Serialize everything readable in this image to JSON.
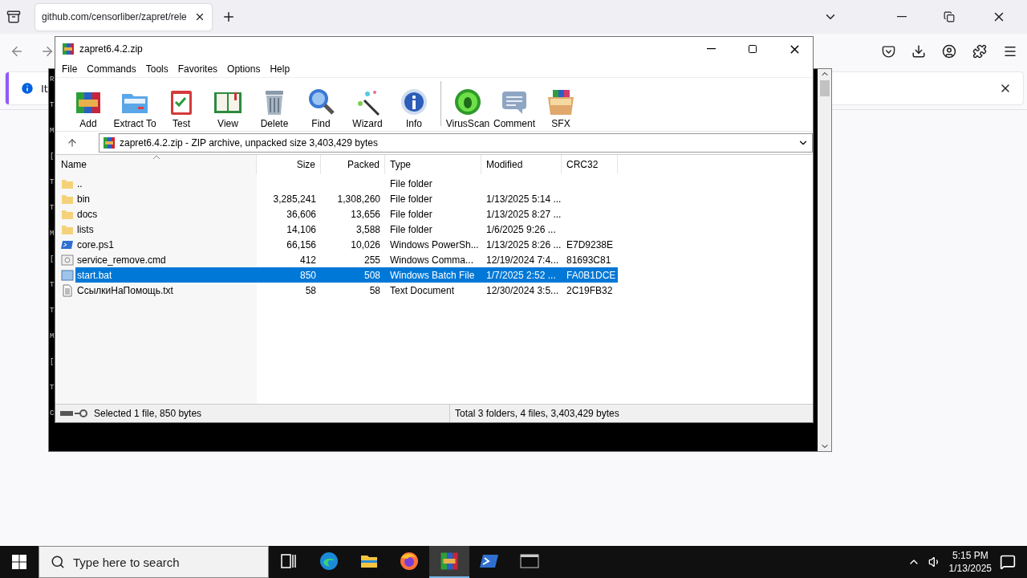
{
  "browser": {
    "tab_title": "github.com/censorliber/zapret/rele",
    "notification_text": "It"
  },
  "console": {
    "lines": [
      "R",
      "T",
      "M",
      "[",
      "T",
      "T",
      "M",
      "[",
      "T",
      "T",
      "M",
      "[",
      "T",
      "C"
    ]
  },
  "archive_window": {
    "title": "zapret6.4.2.zip",
    "menu": [
      "File",
      "Commands",
      "Tools",
      "Favorites",
      "Options",
      "Help"
    ],
    "toolbar": [
      {
        "label": "Add",
        "kind": "add"
      },
      {
        "label": "Extract To",
        "kind": "extract"
      },
      {
        "label": "Test",
        "kind": "test"
      },
      {
        "label": "View",
        "kind": "view"
      },
      {
        "label": "Delete",
        "kind": "delete"
      },
      {
        "label": "Find",
        "kind": "find"
      },
      {
        "label": "Wizard",
        "kind": "wizard"
      },
      {
        "label": "Info",
        "kind": "info"
      },
      {
        "label": "VirusScan",
        "kind": "virusscan"
      },
      {
        "label": "Comment",
        "kind": "comment"
      },
      {
        "label": "SFX",
        "kind": "sfx"
      }
    ],
    "path": "zapret6.4.2.zip - ZIP archive, unpacked size 3,403,429 bytes",
    "columns": [
      {
        "label": "Name",
        "sorted": true
      },
      {
        "label": "Size",
        "sorted": false
      },
      {
        "label": "Packed",
        "sorted": false
      },
      {
        "label": "Type",
        "sorted": false
      },
      {
        "label": "Modified",
        "sorted": false
      },
      {
        "label": "CRC32",
        "sorted": false
      }
    ],
    "rows": [
      {
        "kind": "folder",
        "name": "..",
        "type": "File folder",
        "selected": false
      },
      {
        "kind": "folder",
        "name": "bin",
        "size": "3,285,241",
        "packed": "1,308,260",
        "type": "File folder",
        "modified": "1/13/2025 5:14 ...",
        "selected": false
      },
      {
        "kind": "folder",
        "name": "docs",
        "size": "36,606",
        "packed": "13,656",
        "type": "File folder",
        "modified": "1/13/2025 8:27 ...",
        "selected": false
      },
      {
        "kind": "folder",
        "name": "lists",
        "size": "14,106",
        "packed": "3,588",
        "type": "File folder",
        "modified": "1/6/2025 9:26 ...",
        "selected": false
      },
      {
        "kind": "powershell",
        "name": "core.ps1",
        "size": "66,156",
        "packed": "10,026",
        "type": "Windows PowerSh...",
        "modified": "1/13/2025 8:26 ...",
        "crc": "E7D9238E",
        "selected": false
      },
      {
        "kind": "script",
        "name": "service_remove.cmd",
        "size": "412",
        "packed": "255",
        "type": "Windows Comma...",
        "modified": "12/19/2024 7:4...",
        "crc": "81693C81",
        "selected": false
      },
      {
        "kind": "batch",
        "name": "start.bat",
        "size": "850",
        "packed": "508",
        "type": "Windows Batch File",
        "modified": "1/7/2025 2:52 ...",
        "crc": "FA0B1DCE",
        "selected": true
      },
      {
        "kind": "text",
        "name": "СсылкиНаПомощь.txt",
        "size": "58",
        "packed": "58",
        "type": "Text Document",
        "modified": "12/30/2024 3:5...",
        "crc": "2C19FB32",
        "selected": false
      }
    ],
    "status": {
      "selection": "Selected 1 file, 850 bytes",
      "total": "Total 3 folders, 4 files, 3,403,429 bytes"
    }
  },
  "taskbar": {
    "search_placeholder": "Type here to search",
    "apps": [
      {
        "kind": "taskview",
        "selected": false
      },
      {
        "kind": "edge",
        "selected": false
      },
      {
        "kind": "explorer",
        "selected": false
      },
      {
        "kind": "firefox",
        "selected": false
      },
      {
        "kind": "winrar",
        "selected": true
      },
      {
        "kind": "powershell",
        "selected": false
      },
      {
        "kind": "terminal",
        "selected": false
      }
    ],
    "time": "5:15 PM",
    "date": "1/13/2025"
  }
}
